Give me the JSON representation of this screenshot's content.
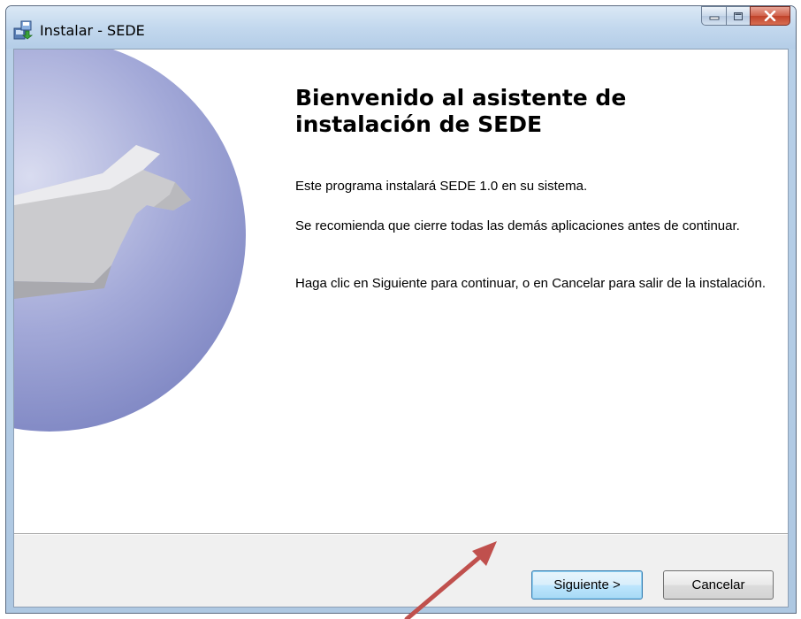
{
  "window": {
    "title": "Instalar - SEDE",
    "app_icon": "installer-icon",
    "controls": {
      "minimize_icon": "minimize-icon",
      "maximize_icon": "maximize-icon",
      "close_icon": "close-icon"
    }
  },
  "side_panel": {
    "graphic": "wrench-on-sphere-graphic"
  },
  "content": {
    "heading": "Bienvenido al asistente de instalación de SEDE",
    "paragraph_1": "Este programa instalará SEDE 1.0 en su sistema.",
    "paragraph_2": "Se recomienda que cierre todas las demás aplicaciones antes de continuar.",
    "paragraph_3": "Haga clic en Siguiente para continuar, o en Cancelar para salir de la instalación."
  },
  "footer": {
    "next_label": "Siguiente >",
    "cancel_label": "Cancelar"
  },
  "annotation": {
    "arrow_color": "#c0504d",
    "points_to": "next-button"
  },
  "colors": {
    "titlebar": "#c3d8ee",
    "close_button": "#c0422a",
    "sphere": "#8f96cc",
    "footer": "#f0f0f0"
  }
}
